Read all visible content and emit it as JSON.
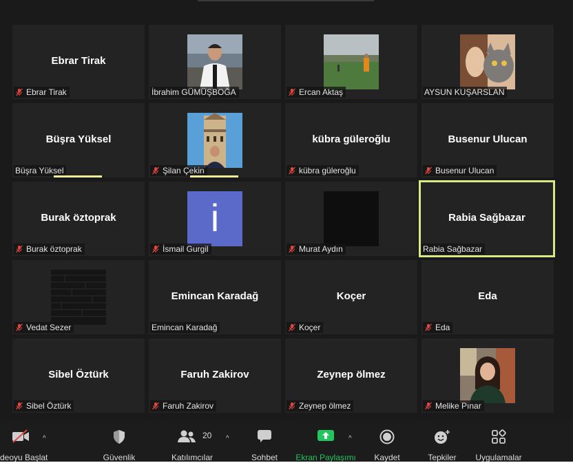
{
  "participants": [
    {
      "display": "Ebrar Tirak",
      "label": "Ebrar Tirak",
      "muted": true
    },
    {
      "display": "",
      "label": "İbrahim GÜMÜŞBOĞA",
      "muted": false,
      "photo": "man-suit"
    },
    {
      "display": "",
      "label": "Ercan Aktaş",
      "muted": true,
      "photo": "football-field"
    },
    {
      "display": "",
      "label": "AYSUN KUŞARSLAN",
      "muted": false,
      "photo": "cat-woman"
    },
    {
      "display": "Büşra Yüksel",
      "label": "Büşra Yüksel",
      "muted": false,
      "speaking": true
    },
    {
      "display": "",
      "label": "Şilan Çekin",
      "muted": true,
      "photo": "galata-tower",
      "speaking": true
    },
    {
      "display": "kübra güleroğlu",
      "label": "kübra güleroğlu",
      "muted": true
    },
    {
      "display": "Busenur Ulucan",
      "label": "Busenur Ulucan",
      "muted": true
    },
    {
      "display": "Burak öztoprak",
      "label": "Burak öztoprak",
      "muted": true
    },
    {
      "display": "",
      "label": "İsmail Gurgil",
      "muted": true,
      "photo": "letter-i",
      "initial": "i"
    },
    {
      "display": "",
      "label": "Murat Aydın",
      "muted": true,
      "photo": "black"
    },
    {
      "display": "Rabia Sağbazar",
      "label": "Rabia Sağbazar",
      "muted": false,
      "active": true
    },
    {
      "display": "",
      "label": "Vedat Sezer",
      "muted": true,
      "photo": "dark-texture"
    },
    {
      "display": "Emincan Karadağ",
      "label": "Emincan Karadağ",
      "muted": false
    },
    {
      "display": "Koçer",
      "label": "Koçer",
      "muted": true
    },
    {
      "display": "Eda",
      "label": "Eda",
      "muted": true
    },
    {
      "display": "Sibel Öztürk",
      "label": "Sibel Öztürk",
      "muted": true
    },
    {
      "display": "Faruh Zakirov",
      "label": "Faruh Zakirov",
      "muted": true
    },
    {
      "display": "Zeynep ölmez",
      "label": "Zeynep ölmez",
      "muted": true
    },
    {
      "display": "",
      "label": "Melike Pınar",
      "muted": true,
      "photo": "girl-smile"
    }
  ],
  "toolbar": {
    "video": {
      "label": "deoyu Başlat",
      "icon": "video-off-icon"
    },
    "security": {
      "label": "Güvenlik",
      "icon": "shield-icon"
    },
    "participants": {
      "label": "Katılımcılar",
      "count": "20",
      "icon": "people-icon"
    },
    "chat": {
      "label": "Sohbet",
      "icon": "chat-icon"
    },
    "share": {
      "label": "Ekran Paylaşımı",
      "icon": "share-screen-icon"
    },
    "record": {
      "label": "Kaydet",
      "icon": "record-icon"
    },
    "reactions": {
      "label": "Tepkiler",
      "icon": "emoji-icon"
    },
    "apps": {
      "label": "Uygulamalar",
      "icon": "apps-icon"
    }
  },
  "colors": {
    "background": "#1a1a1a",
    "tile": "#232323",
    "mute_red": "#e0473f",
    "share_green": "#22c55e",
    "active_speaker": "#d7eb84",
    "speaking_bar": "#f3ef9a"
  }
}
